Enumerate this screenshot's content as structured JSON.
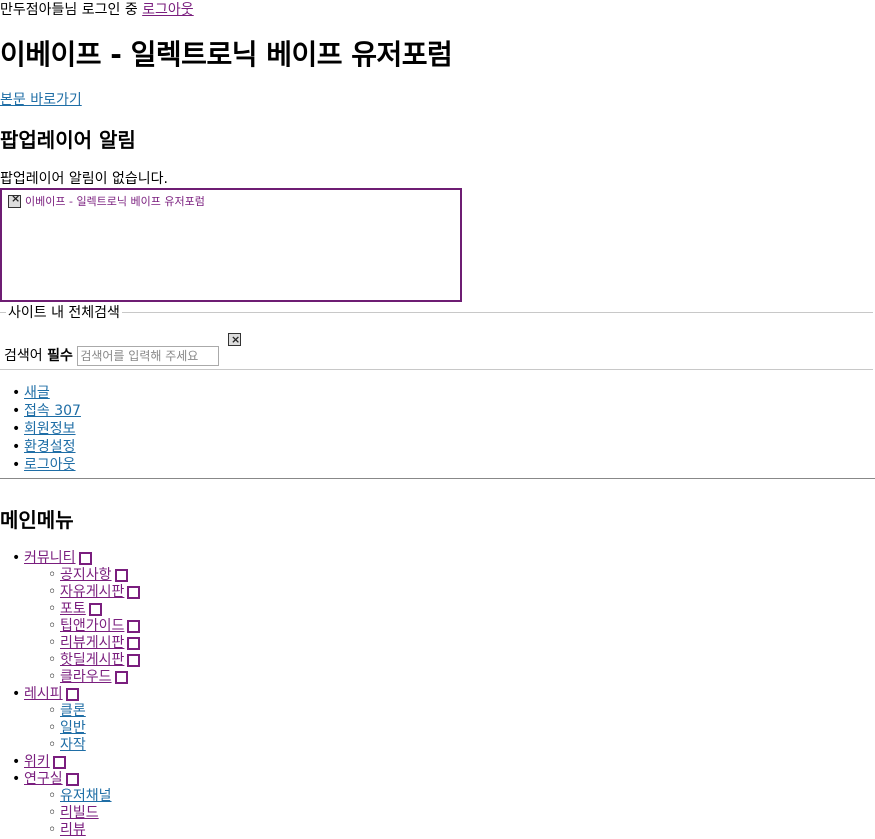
{
  "login": {
    "text": "만두점아들님 로그인 중 ",
    "logout_link": "로그아웃"
  },
  "site_title": "이베이프 - 일렉트로닉 베이프 유저포럼",
  "skip_link": "본문 바로가기",
  "popup": {
    "heading": "팝업레이어 알림",
    "empty_text": "팝업레이어 알림이 없습니다.",
    "frame_text": "이베이프 - 일렉트로닉 베이프 유저포럼"
  },
  "search": {
    "legend": "사이트 내 전체검색",
    "label": "검색어 ",
    "required": "필수",
    "placeholder": "검색어를 입력해 주세요"
  },
  "util_links": [
    "새글",
    "접속 307",
    "회원정보",
    "환경설정",
    "로그아웃"
  ],
  "main_menu": {
    "heading": "메인메뉴",
    "community": {
      "label": "커뮤니티",
      "items": [
        "공지사항",
        "자유게시판",
        "포토",
        "팁앤가이드",
        "리뷰게시판",
        "핫딜게시판",
        "클라우드"
      ]
    },
    "recipe": {
      "label": "레시피",
      "items": [
        "클론",
        "일반",
        "자작"
      ]
    },
    "wiki": {
      "label": "위키"
    },
    "lab": {
      "label": "연구실",
      "items": [
        "유저채널",
        "리빌드",
        "리뷰"
      ]
    }
  }
}
